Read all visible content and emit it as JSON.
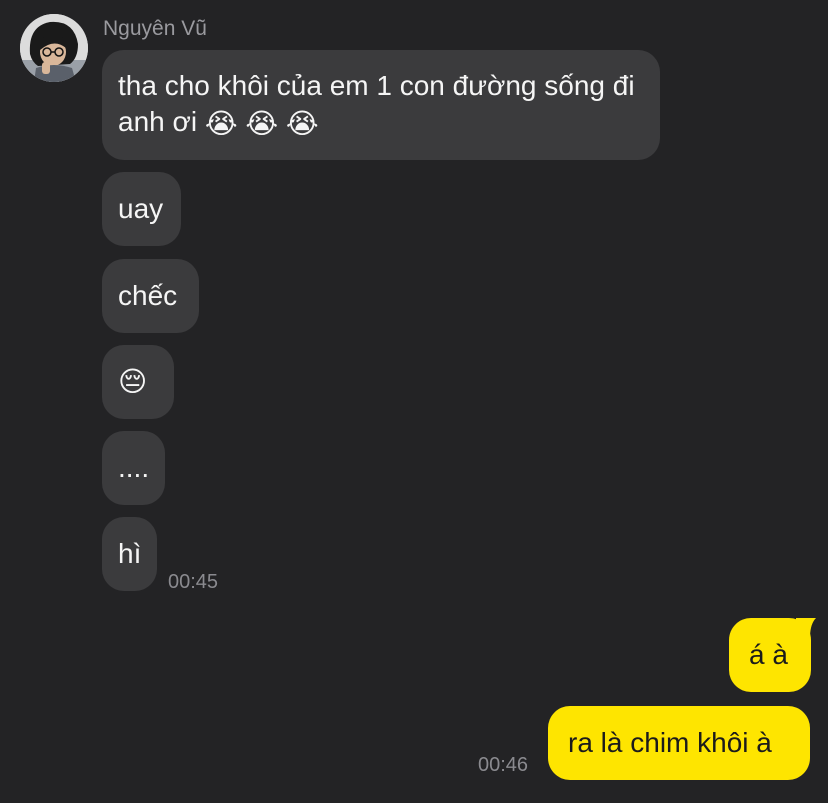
{
  "sender": {
    "name": "Nguyên Vũ"
  },
  "incoming": [
    {
      "text": "tha cho khôi của em 1 con đường sống đi anh ơi",
      "emoji": [
        "😭",
        "😭",
        "😭"
      ]
    },
    {
      "text": "uay"
    },
    {
      "text": "chếc"
    },
    {
      "emoji": "😔"
    },
    {
      "text": "...."
    },
    {
      "text": "hì"
    }
  ],
  "incoming_time": "00:45",
  "outgoing": [
    {
      "text": "á à"
    },
    {
      "text": "ra là chim khôi à"
    }
  ],
  "outgoing_time": "00:46",
  "colors": {
    "background": "#232325",
    "incoming_bubble": "#3b3b3d",
    "outgoing_bubble": "#fee500"
  }
}
